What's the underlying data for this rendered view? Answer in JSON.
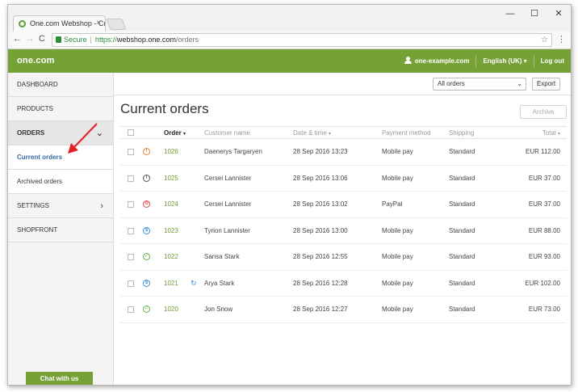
{
  "browser": {
    "tab_title": "One.com Webshop - Cur",
    "tab_close": "×",
    "window_controls": [
      "—",
      "☐",
      "✕"
    ],
    "nav": {
      "back": "←",
      "forward": "→",
      "reload": "C"
    },
    "secure_label": "Secure",
    "url_scheme": "https://",
    "url_host": "webshop.one.com",
    "url_path": "/orders",
    "star": "☆",
    "menu": "⋮"
  },
  "header": {
    "logo": "one.com",
    "account": "one-example.com",
    "language": "English (UK) ▾",
    "logout": "Log out",
    "color": "#76a137"
  },
  "sidebar": {
    "items": [
      {
        "label": "DASHBOARD"
      },
      {
        "label": "PRODUCTS"
      },
      {
        "label": "ORDERS",
        "arrow": "⌄"
      },
      {
        "label": "SETTINGS",
        "arrow": "›"
      },
      {
        "label": "SHOPFRONT"
      }
    ],
    "subitems": [
      {
        "label": "Current orders",
        "active": true
      },
      {
        "label": "Archived orders"
      }
    ],
    "chat_label": "Chat with us"
  },
  "toolbar": {
    "filter_value": "All orders",
    "export_label": "Export"
  },
  "main": {
    "title": "Current orders",
    "archive_label": "Archive"
  },
  "table": {
    "headers": {
      "order": "Order",
      "customer": "Customer name",
      "date": "Date & time",
      "payment": "Payment method",
      "shipping": "Shipping",
      "total": "Total"
    },
    "rows": [
      {
        "status": "pending",
        "status_glyph": "!",
        "order": "1026",
        "refund": "",
        "customer": "Daenerys Targaryen",
        "date": "28 Sep 2016 13:23",
        "payment": "Mobile pay",
        "shipping": "Standard",
        "total": "EUR 112.00"
      },
      {
        "status": "processing",
        "status_glyph": "!",
        "order": "1025",
        "refund": "",
        "customer": "Cersei Lannister",
        "date": "28 Sep 2016 13:06",
        "payment": "Mobile pay",
        "shipping": "Standard",
        "total": "EUR 37.00"
      },
      {
        "status": "cancelled",
        "status_glyph": "⊘",
        "order": "1024",
        "refund": "",
        "customer": "Cersei Lannister",
        "date": "28 Sep 2016 13:02",
        "payment": "PayPal",
        "shipping": "Standard",
        "total": "EUR 37.00"
      },
      {
        "status": "paid",
        "status_glyph": "$",
        "order": "1023",
        "refund": "",
        "customer": "Tyrion Lannister",
        "date": "28 Sep 2016 13:00",
        "payment": "Mobile pay",
        "shipping": "Standard",
        "total": "EUR 88.00"
      },
      {
        "status": "done",
        "status_glyph": "✓",
        "order": "1022",
        "refund": "",
        "customer": "Sansa Stark",
        "date": "28 Sep 2016 12:55",
        "payment": "Mobile pay",
        "shipping": "Standard",
        "total": "EUR 93.00"
      },
      {
        "status": "paid",
        "status_glyph": "$",
        "order": "1021",
        "refund": "↻",
        "customer": "Arya Stark",
        "date": "28 Sep 2016 12:28",
        "payment": "Mobile pay",
        "shipping": "Standard",
        "total": "EUR 102.00"
      },
      {
        "status": "done",
        "status_glyph": "✓",
        "order": "1020",
        "refund": "",
        "customer": "Jon Snow",
        "date": "28 Sep 2016 12:27",
        "payment": "Mobile pay",
        "shipping": "Standard",
        "total": "EUR 73.00"
      }
    ]
  },
  "colors": {
    "accent_green": "#76a137",
    "active_link_blue": "#3569a8",
    "annotation_red": "#e31e24"
  }
}
